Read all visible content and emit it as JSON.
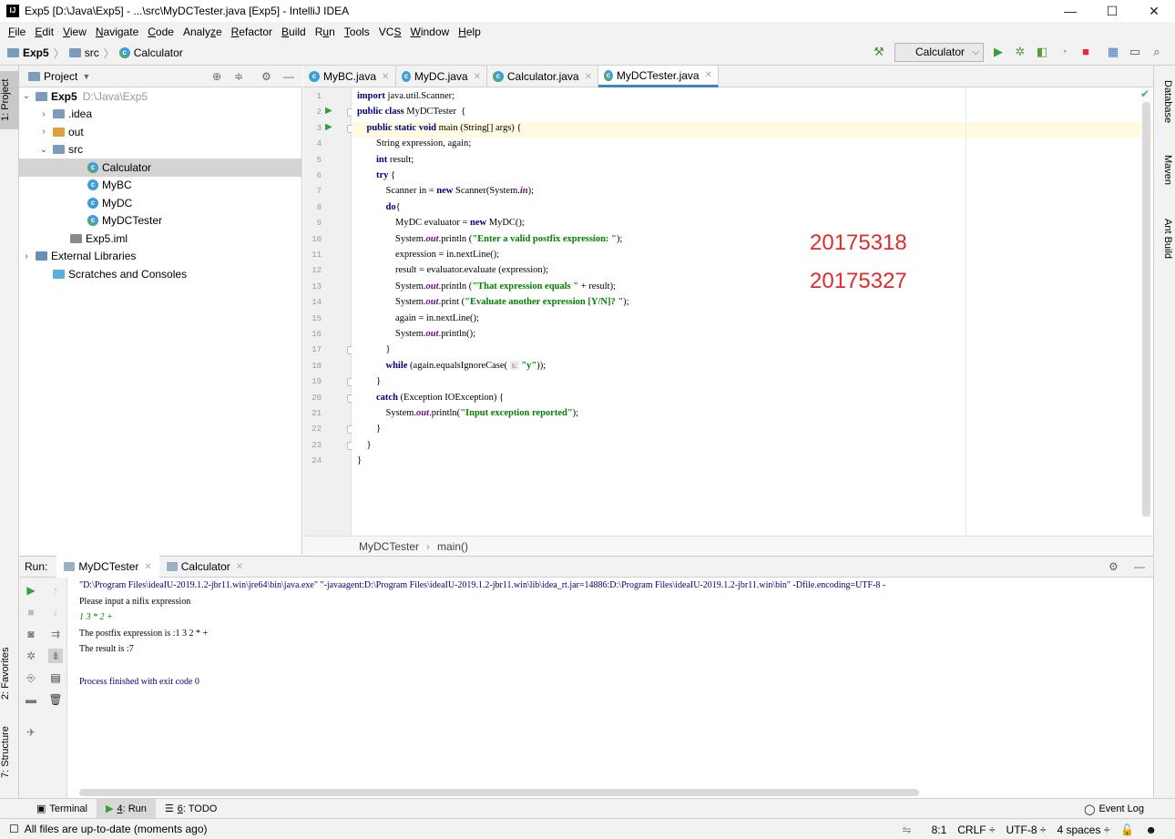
{
  "window": {
    "title": "Exp5 [D:\\Java\\Exp5] - ...\\src\\MyDCTester.java [Exp5] - IntelliJ IDEA",
    "app_icon": "IJ",
    "minimize": "—",
    "maximize": "☐",
    "close": "✕"
  },
  "menu": [
    {
      "u": "F",
      "rest": "ile"
    },
    {
      "u": "E",
      "rest": "dit"
    },
    {
      "u": "V",
      "rest": "iew"
    },
    {
      "u": "N",
      "rest": "avigate"
    },
    {
      "u": "C",
      "rest": "ode"
    },
    {
      "pre": "Analy",
      "u": "z",
      "rest": "e"
    },
    {
      "u": "R",
      "rest": "efactor"
    },
    {
      "u": "B",
      "rest": "uild"
    },
    {
      "pre": "R",
      "u": "u",
      "rest": "n"
    },
    {
      "u": "T",
      "rest": "ools"
    },
    {
      "pre": "VC",
      "u": "S",
      "rest": ""
    },
    {
      "u": "W",
      "rest": "indow"
    },
    {
      "u": "H",
      "rest": "elp"
    }
  ],
  "navbar": {
    "crumbs": [
      "Exp5",
      "src",
      "Calculator"
    ],
    "run_config": "Calculator"
  },
  "left_strip": {
    "project_tab": "1: Project",
    "favorites_tab": "2: Favorites",
    "structure_tab": "7: Structure"
  },
  "right_strip": {
    "database_tab": "Database",
    "maven_tab": "Maven",
    "ant_tab": "Ant Build"
  },
  "project": {
    "header": "Project",
    "tree": [
      {
        "label": "Exp5",
        "suffix": "D:\\Java\\Exp5",
        "chev": "⌄",
        "icon": "folder",
        "indent": 0
      },
      {
        "label": ".idea",
        "chev": "›",
        "icon": "folder",
        "indent": 1
      },
      {
        "label": "out",
        "chev": "›",
        "icon": "folder-orange",
        "indent": 1
      },
      {
        "label": "src",
        "chev": "⌄",
        "icon": "folder",
        "indent": 1
      },
      {
        "label": "Calculator",
        "icon": "class-main",
        "indent": 3,
        "selected": true
      },
      {
        "label": "MyBC",
        "icon": "class",
        "indent": 3
      },
      {
        "label": "MyDC",
        "icon": "class",
        "indent": 3
      },
      {
        "label": "MyDCTester",
        "icon": "class-main",
        "indent": 3
      },
      {
        "label": "Exp5.iml",
        "icon": "file",
        "indent": 2
      },
      {
        "label": "External Libraries",
        "chev": "›",
        "icon": "library",
        "indent": 0
      },
      {
        "label": "Scratches and Consoles",
        "icon": "scratch",
        "indent": 1
      }
    ]
  },
  "editor_tabs": [
    {
      "label": "MyBC.java"
    },
    {
      "label": "MyDC.java"
    },
    {
      "label": "Calculator.java"
    },
    {
      "label": "MyDCTester.java",
      "active": true
    }
  ],
  "code": {
    "line_numbers": [
      "1",
      "2",
      "3",
      "4",
      "5",
      "6",
      "7",
      "8",
      "9",
      "10",
      "11",
      "12",
      "13",
      "14",
      "15",
      "16",
      "17",
      "18",
      "19",
      "20",
      "21",
      "22",
      "23",
      "24"
    ],
    "lines": [
      "import java.util.Scanner;",
      "public class MyDCTester  {",
      "    public static void main (String[] args) {",
      "        String expression, again;",
      "        int result;",
      "        try {",
      "            Scanner in = new Scanner(System.in);",
      "            do{",
      "                MyDC evaluator = new MyDC();",
      "                System.out.println (\"Enter a valid postfix expression: \");",
      "                expression = in.nextLine();",
      "                result = evaluator.evaluate (expression);",
      "                System.out.println (\"That expression equals \" + result);",
      "                System.out.print (\"Evaluate another expression [Y/N]? \");",
      "                again = in.nextLine();",
      "                System.out.println();",
      "            }",
      "            while (again.equalsIgnoreCase( s: \"y\"));",
      "        }",
      "        catch (Exception IOException) {",
      "            System.out.println(\"Input exception reported\");",
      "        }",
      "    }",
      "}"
    ],
    "annotations": [
      "20175318",
      "20175327"
    ]
  },
  "editor_breadcrumb": [
    "MyDCTester",
    "main()"
  ],
  "run": {
    "label": "Run:",
    "tabs": [
      "MyDCTester",
      "Calculator"
    ],
    "console": [
      {
        "text": "\"D:\\Program Files\\ideaIU-2019.1.2-jbr11.win\\jre64\\bin\\java.exe\" \"-javaagent:D:\\Program Files\\ideaIU-2019.1.2-jbr11.win\\lib\\idea_rt.jar=14886:D:\\Program Files\\ideaIU-2019.1.2-jbr11.win\\bin\" -Dfile.encoding=UTF-8 -",
        "kind": "cmd"
      },
      {
        "text": "Please input a nifix expression",
        "kind": "out"
      },
      {
        "text": "1 3 * 2 +",
        "kind": "in"
      },
      {
        "text": "The postfix expression is :1 3 2 * +",
        "kind": "out"
      },
      {
        "text": "The result is :7",
        "kind": "out"
      },
      {
        "text": "",
        "kind": "out"
      },
      {
        "text": "Process finished with exit code 0",
        "kind": "cmd"
      }
    ]
  },
  "tool_tabs": {
    "terminal": "Terminal",
    "run_num": "4",
    "run_rest": ": Run",
    "todo_num": "6",
    "todo_rest": ": TODO",
    "event_log": "Event Log"
  },
  "status": {
    "message": "All files are up-to-date (moments ago)",
    "position": "8:1",
    "line_sep": "CRLF ÷",
    "encoding": "UTF-8 ÷",
    "indent": "4 spaces ÷"
  },
  "colors": {
    "accent": "#4083c9",
    "run_green": "#389e3b",
    "annotation_red": "#e02c2c",
    "keyword": "#000080",
    "string": "#008000"
  }
}
